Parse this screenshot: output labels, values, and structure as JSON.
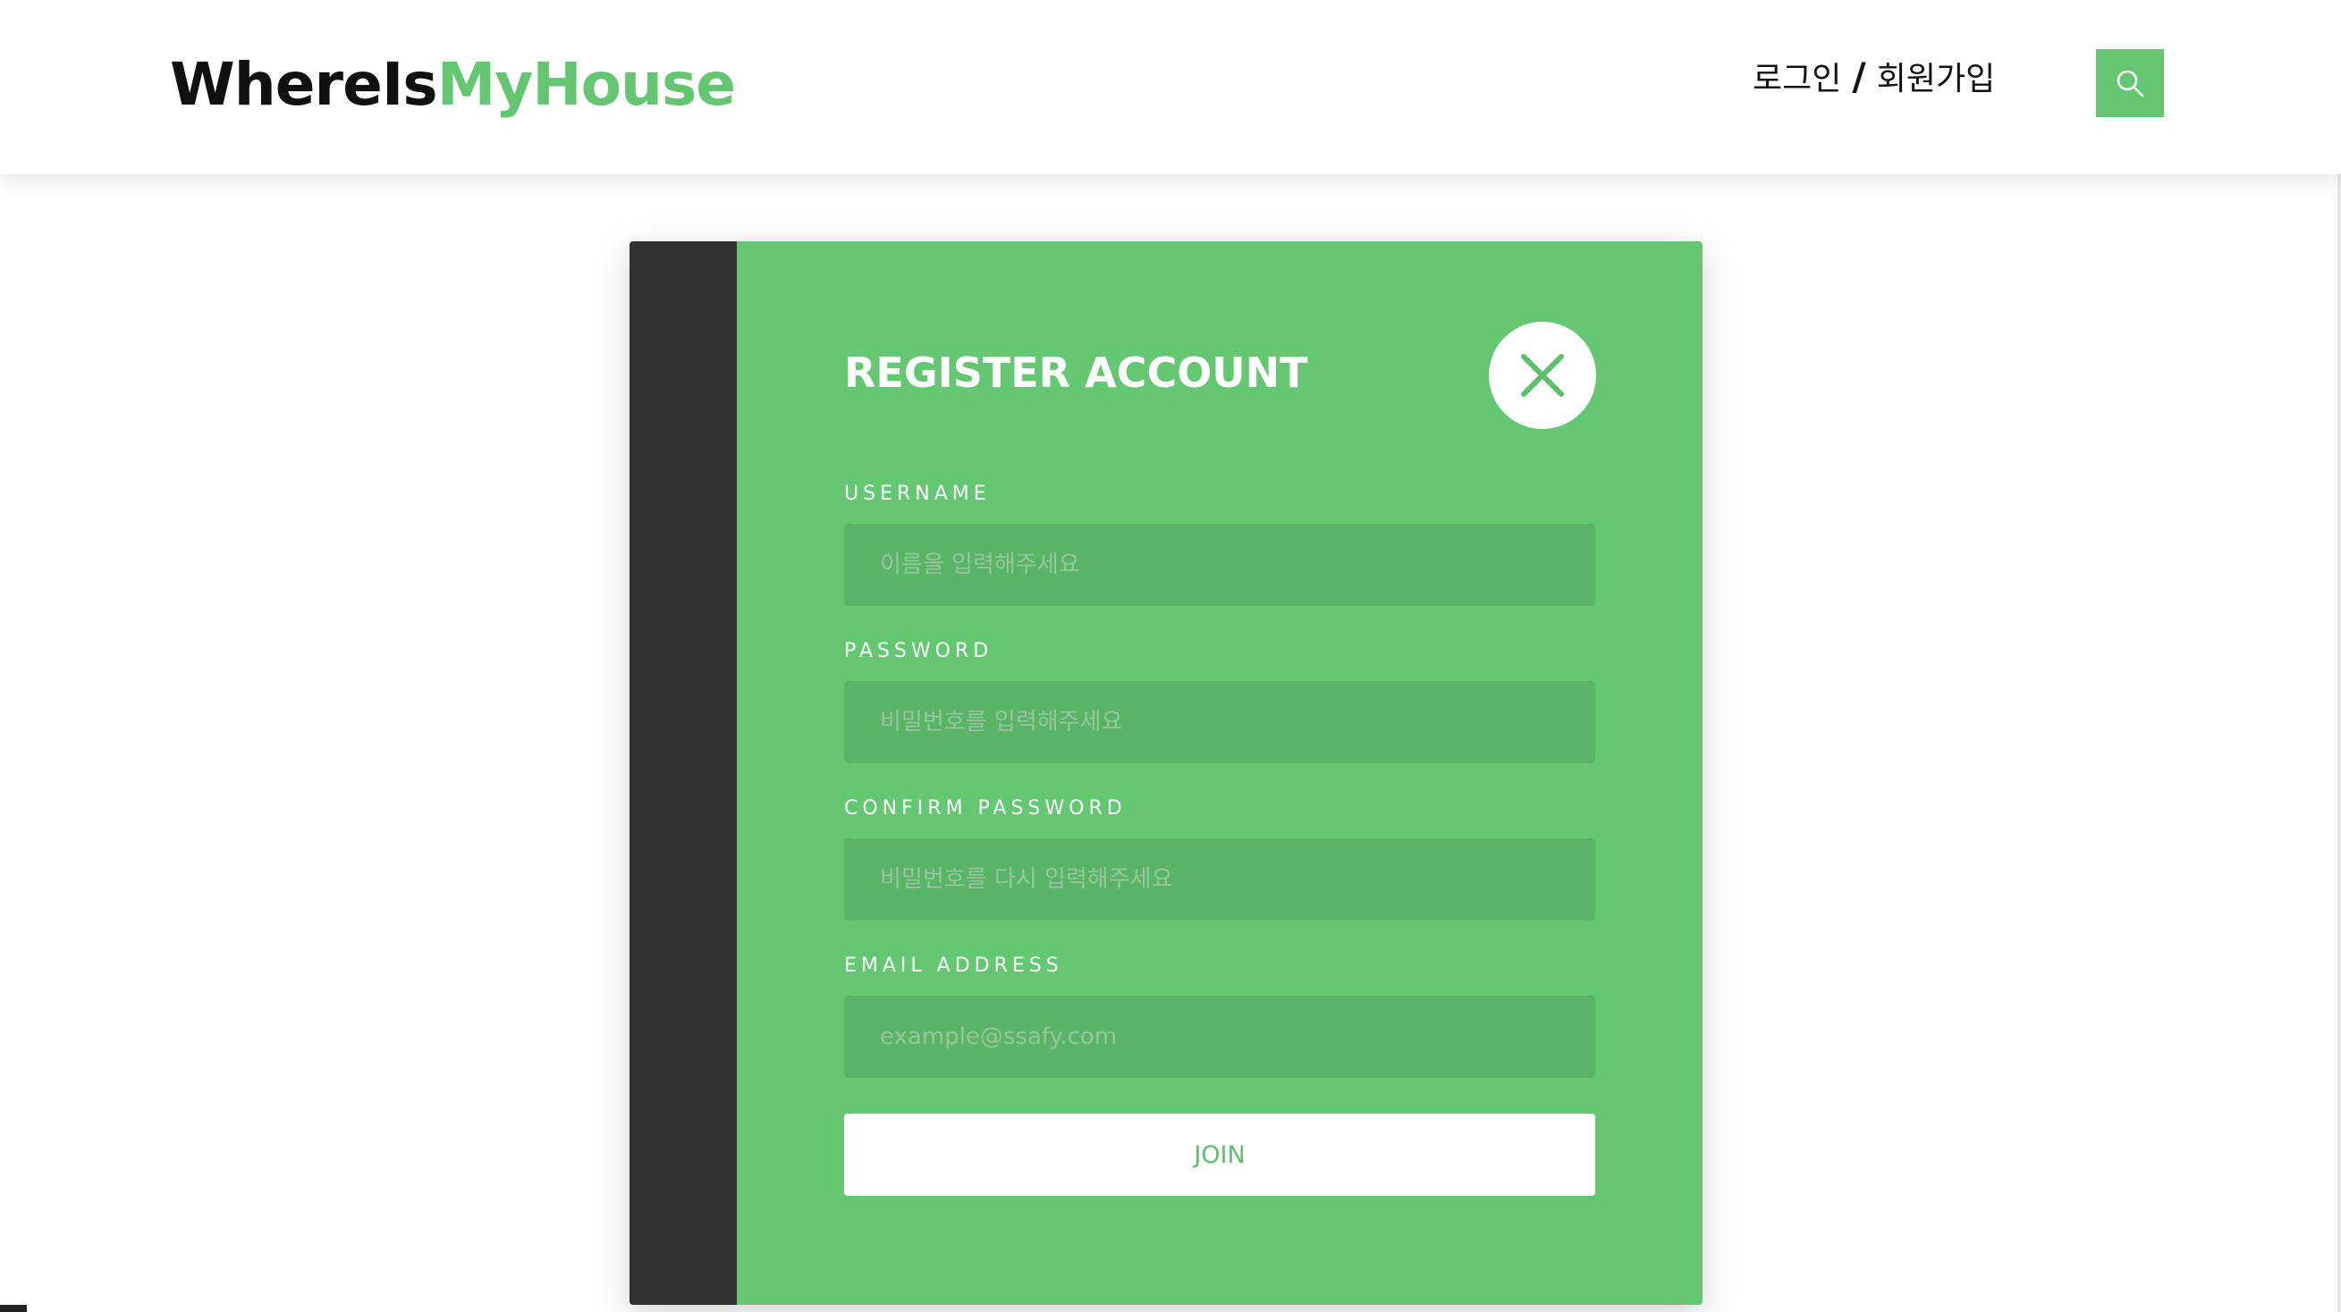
{
  "header": {
    "logo_part1": "WhereIs",
    "logo_part2": "MyHouse",
    "login_label": "로그인",
    "separator": "/",
    "signup_label": "회원가입",
    "search_icon": "search-icon"
  },
  "modal": {
    "title": "REGISTER ACCOUNT",
    "close_icon": "close-icon",
    "fields": [
      {
        "label": "USERNAME",
        "placeholder": "이름을 입력해주세요",
        "value": ""
      },
      {
        "label": "PASSWORD",
        "placeholder": "비밀번호를 입력해주세요",
        "value": ""
      },
      {
        "label": "CONFIRM PASSWORD",
        "placeholder": "비밀번호를 다시 입력해주세요",
        "value": ""
      },
      {
        "label": "EMAIL ADDRESS",
        "placeholder": "example@ssafy.com",
        "value": ""
      }
    ],
    "submit_label": "JOIN"
  },
  "colors": {
    "brand_green": "#63c771",
    "panel_green": "#64c772",
    "input_green": "#5ab468",
    "side_dark": "#323232",
    "text_dark": "#111111"
  }
}
